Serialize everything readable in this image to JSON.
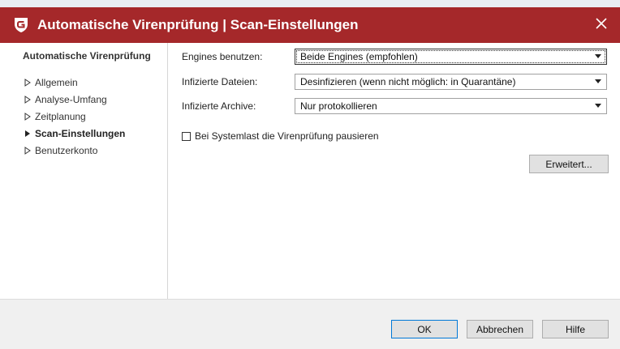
{
  "window": {
    "title": "Automatische Virenprüfung | Scan-Einstellungen",
    "logo_icon": "gdata-shield-icon",
    "close_icon": "close-icon",
    "title_bg": "#a5282a"
  },
  "nav": {
    "heading": "Automatische Virenprüfung",
    "items": [
      {
        "label": "Allgemein",
        "active": false
      },
      {
        "label": "Analyse-Umfang",
        "active": false
      },
      {
        "label": "Zeitplanung",
        "active": false
      },
      {
        "label": "Scan-Einstellungen",
        "active": true
      },
      {
        "label": "Benutzerkonto",
        "active": false
      }
    ]
  },
  "settings": {
    "engines": {
      "label": "Engines benutzen:",
      "value": "Beide Engines (empfohlen)"
    },
    "infected_files": {
      "label": "Infizierte Dateien:",
      "value": "Desinfizieren (wenn nicht möglich: in Quarantäne)"
    },
    "infected_archives": {
      "label": "Infizierte Archive:",
      "value": "Nur protokollieren"
    },
    "pause_checkbox": {
      "label": "Bei Systemlast die Virenprüfung pausieren",
      "checked": false
    },
    "advanced_button": "Erweitert..."
  },
  "footer": {
    "ok": "OK",
    "cancel": "Abbrechen",
    "help": "Hilfe"
  }
}
